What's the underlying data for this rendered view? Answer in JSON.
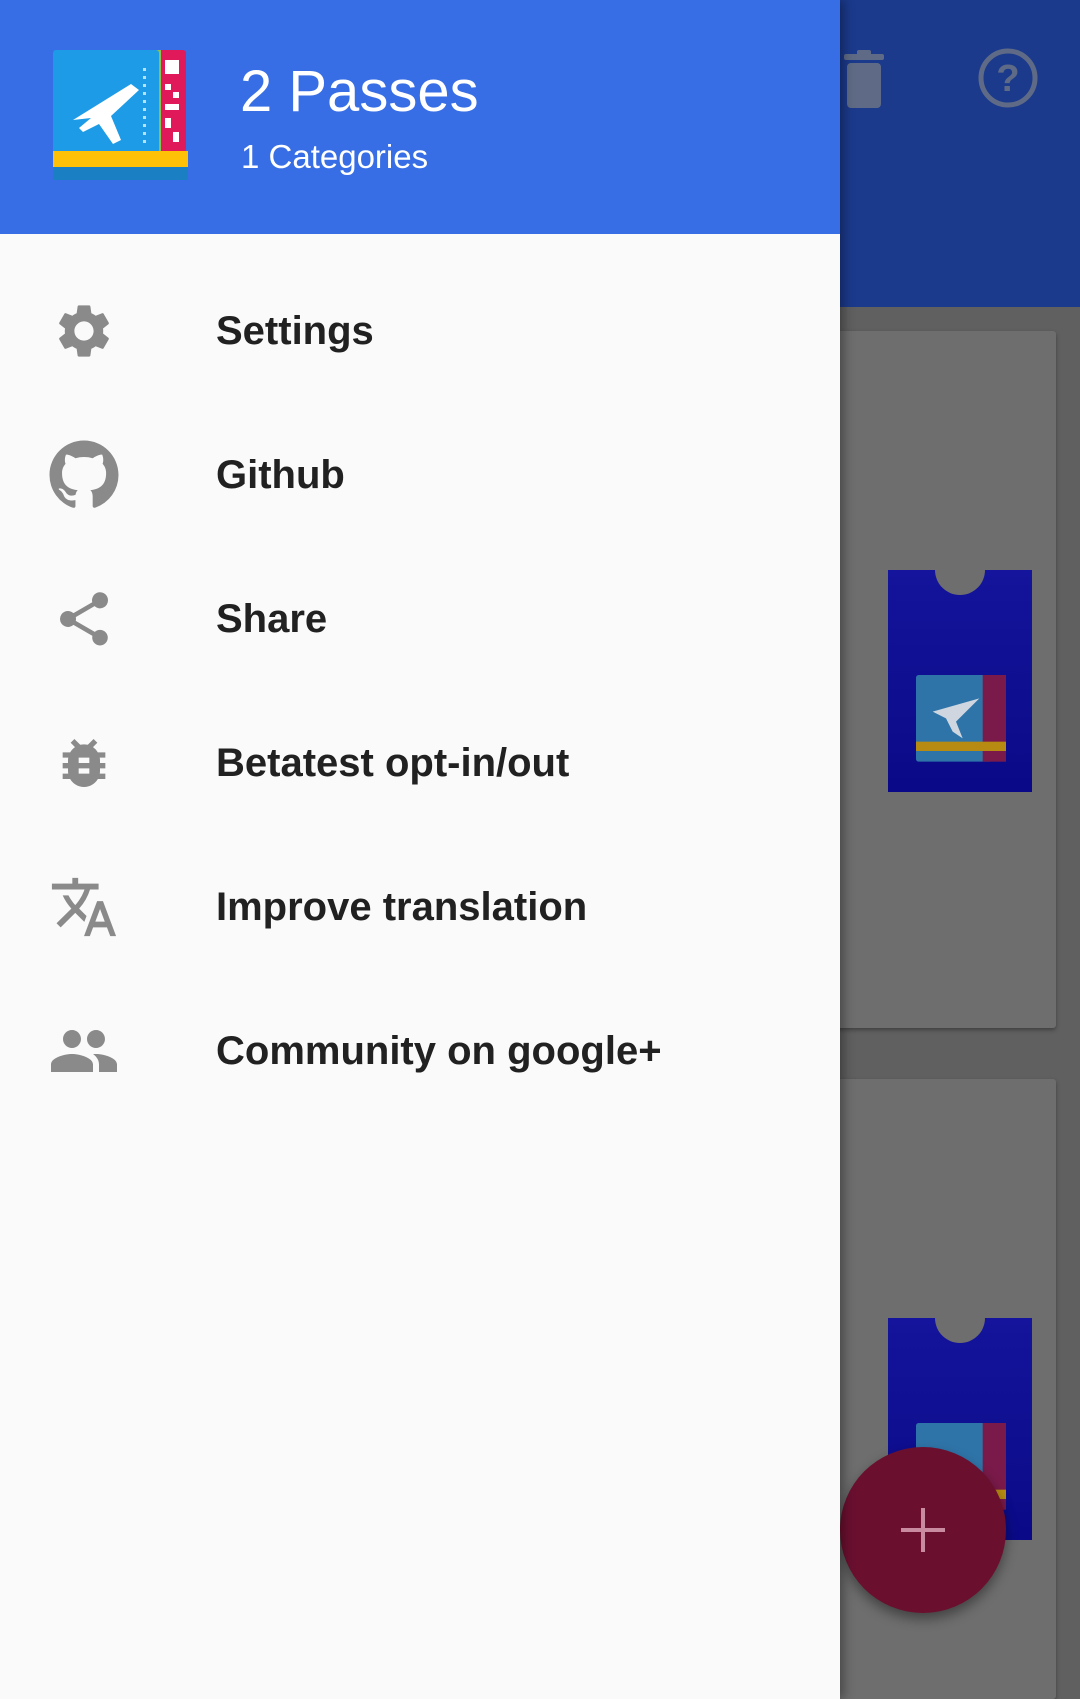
{
  "drawer": {
    "header": {
      "title": "2 Passes",
      "subtitle": "1 Categories",
      "color": "#376ee5"
    },
    "items": [
      {
        "label": "Settings",
        "icon": "gear-icon"
      },
      {
        "label": "Github",
        "icon": "github-icon"
      },
      {
        "label": "Share",
        "icon": "share-icon"
      },
      {
        "label": "Betatest opt-in/out",
        "icon": "bug-icon"
      },
      {
        "label": "Improve translation",
        "icon": "translate-icon"
      },
      {
        "label": "Community on google+",
        "icon": "people-icon"
      }
    ]
  },
  "background": {
    "toolbar_actions": [
      "delete-icon",
      "help-icon"
    ],
    "fab": {
      "icon": "plus-icon",
      "color": "#6b0f2f"
    },
    "accent": "#1b3a8c"
  }
}
